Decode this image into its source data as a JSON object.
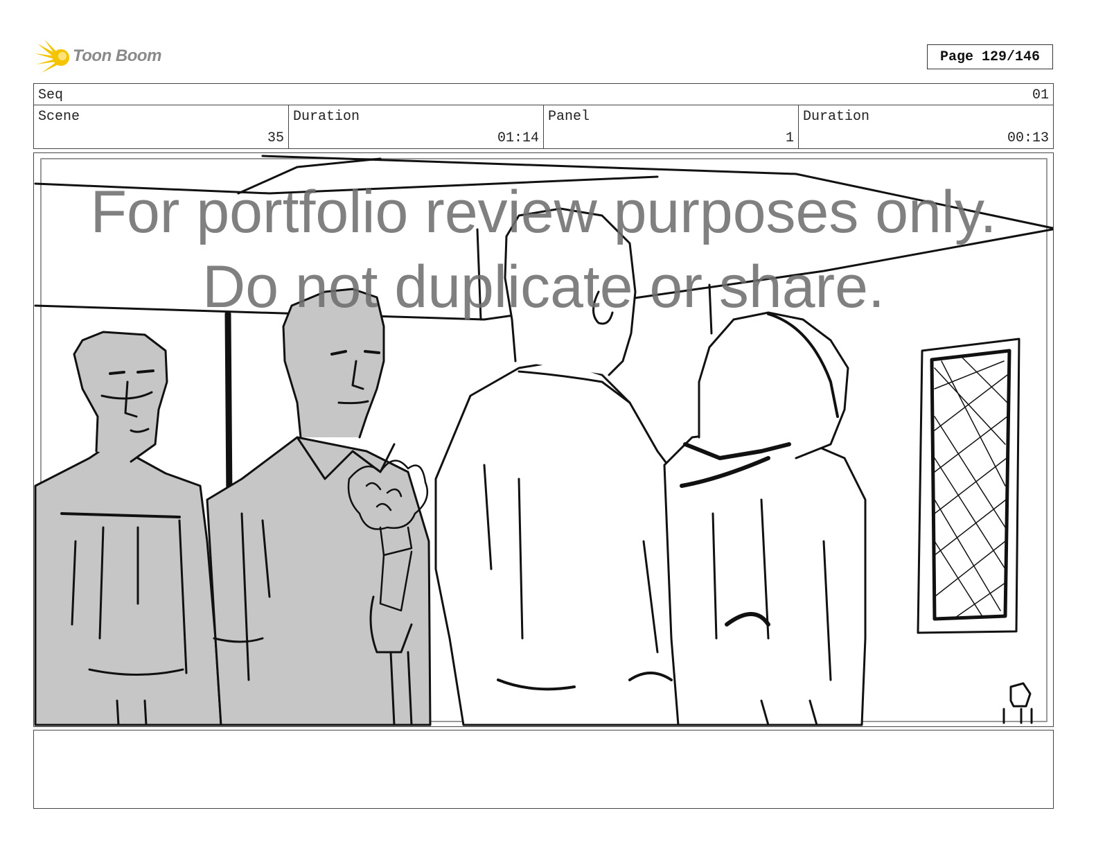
{
  "header": {
    "logo_text": "Toon Boom",
    "page_label": "Page 129/146"
  },
  "info": {
    "seq": {
      "label": "Seq",
      "value": "01"
    },
    "scene": {
      "label": "Scene",
      "value": "35"
    },
    "scene_duration": {
      "label": "Duration",
      "value": "01:14"
    },
    "panel": {
      "label": "Panel",
      "value": "1"
    },
    "panel_duration": {
      "label": "Duration",
      "value": "00:13"
    }
  },
  "watermark": {
    "line1": "For portfolio review purposes only.",
    "line2": "Do not duplicate or share."
  },
  "notes": {
    "text": ""
  },
  "colors": {
    "sketch_fill": "#c6c6c6",
    "ink": "#111111",
    "watermark": "#6e6e6e",
    "logo_accent": "#f5c400"
  }
}
